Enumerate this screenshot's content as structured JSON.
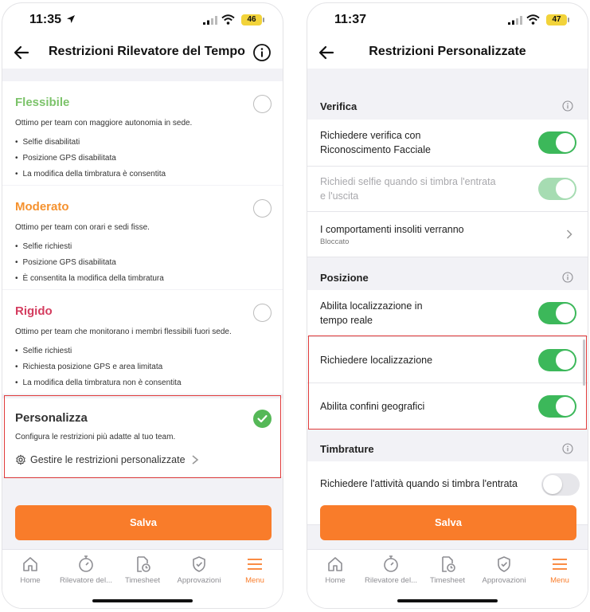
{
  "colors": {
    "accent": "#f97c2a",
    "flessibile": "#7cc36a",
    "moderato": "#f5922f",
    "rigido": "#d43d5f",
    "toggle_on": "#3cb85a",
    "highlight": "#e03a3a"
  },
  "left": {
    "status": {
      "time": "11:35",
      "battery": "46"
    },
    "title": "Restrizioni Rilevatore del Tempo",
    "options": [
      {
        "title": "Flessibile",
        "desc": "Ottimo per team con maggiore autonomia in sede.",
        "bullets": [
          "Selfie disabilitati",
          "Posizione GPS disabilitata",
          "La modifica della timbratura è consentita"
        ]
      },
      {
        "title": "Moderato",
        "desc": "Ottimo per team con orari e sedi fisse.",
        "bullets": [
          "Selfie richiesti",
          "Posizione GPS disabilitata",
          "È consentita la modifica della timbratura"
        ]
      },
      {
        "title": "Rigido",
        "desc": "Ottimo per team che monitorano i membri flessibili fuori sede.",
        "bullets": [
          "Selfie richiesti",
          "Richiesta posizione GPS e area limitata",
          "La modifica della timbratura non è consentita"
        ]
      }
    ],
    "custom": {
      "title": "Personalizza",
      "desc": "Configura le restrizioni più adatte al tuo team.",
      "link": "Gestire le restrizioni personalizzate"
    },
    "save": "Salva"
  },
  "right": {
    "status": {
      "time": "11:37",
      "battery": "47"
    },
    "title": "Restrizioni Personalizzate",
    "sections": {
      "verifica": "Verifica",
      "posizione": "Posizione",
      "timbrature": "Timbrature"
    },
    "rows": {
      "face_line1": "Richiedere verifica con",
      "face_line2": "Riconoscimento Facciale",
      "selfie_line1": "Richiedi selfie quando si timbra l'entrata",
      "selfie_line2": "e l'uscita",
      "unusual_title": "I comportamenti insoliti verranno",
      "unusual_sub": "Bloccato",
      "realtime_line1": "Abilita localizzazione in",
      "realtime_line2": "tempo reale",
      "require_location": "Richiedere localizzazione",
      "geofence": "Abilita confini geografici",
      "activity": "Richiedere l'attività quando si timbra l'entrata"
    },
    "toggles": {
      "face": true,
      "selfie": true,
      "realtime": true,
      "require_location": true,
      "geofence": true,
      "activity": false
    },
    "save": "Salva"
  },
  "tabs": [
    "Home",
    "Rilevatore del...",
    "Timesheet",
    "Approvazioni",
    "Menu"
  ]
}
